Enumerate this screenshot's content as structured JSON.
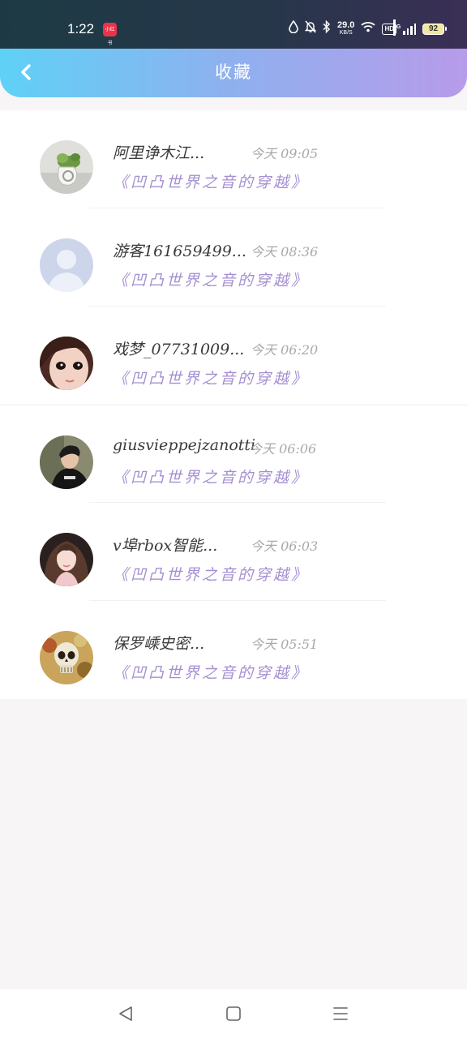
{
  "status_bar": {
    "time": "1:22",
    "app_badge": "小红书",
    "net_speed_value": "29.0",
    "net_speed_unit": "KB/S",
    "hd_label": "HD",
    "network_type": "4G",
    "battery_level": "92",
    "icons": [
      "water-drop-icon",
      "bell-off-icon",
      "bluetooth-icon",
      "wifi-icon",
      "hd-icon",
      "signal-icon",
      "battery-icon"
    ]
  },
  "header": {
    "title": "收藏",
    "back_icon": "chevron-left-icon",
    "gradient": [
      "#5fd1f6",
      "#b79bea"
    ]
  },
  "colors": {
    "title_text": "#a58fd2",
    "name_text": "#3a3a3a",
    "time_text": "#a9a9a9"
  },
  "favorites": [
    {
      "name": "阿里诤木江...",
      "time": "今天 09:05",
      "title": "《凹凸世界之音的穿越》",
      "avatar": "plant-vase-avatar"
    },
    {
      "name": "游客161659499...",
      "time": "今天 08:36",
      "title": "《凹凸世界之音的穿越》",
      "avatar": "default-person-avatar"
    },
    {
      "name": "戏梦_07731009...",
      "time": "今天 06:20",
      "title": "《凹凸世界之音的穿越》",
      "avatar": "doll-face-avatar"
    },
    {
      "name": "giusvieppejzanotti",
      "time": "今天 06:06",
      "title": "《凹凸世界之音的穿越》",
      "avatar": "boy-portrait-avatar"
    },
    {
      "name": "v埠rbox智能...",
      "time": "今天 06:03",
      "title": "《凹凸世界之音的穿越》",
      "avatar": "girl-portrait-avatar"
    },
    {
      "name": "保罗嵊史密...",
      "time": "今天 05:51",
      "title": "《凹凸世界之音的穿越》",
      "avatar": "skull-avatar"
    }
  ],
  "nav_bar": {
    "icons": [
      "back-triangle-icon",
      "home-square-icon",
      "menu-lines-icon"
    ]
  }
}
